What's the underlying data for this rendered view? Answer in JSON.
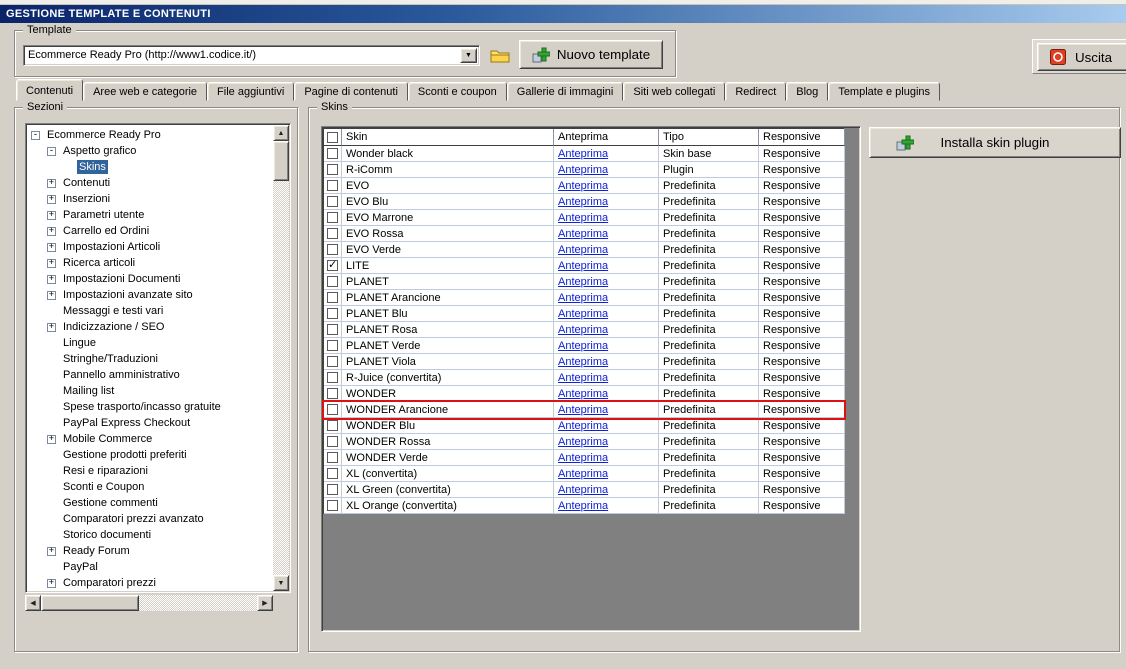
{
  "window": {
    "title": "GESTIONE TEMPLATE E CONTENUTI"
  },
  "colors": {
    "titlebar_start": "#0a246a",
    "titlebar_mid": "#2a5a9c",
    "titlebar_end": "#a8cbee",
    "selection": "#31639c",
    "link": "#0b20d8",
    "highlight": "#dd1111"
  },
  "template": {
    "group_label": "Template",
    "combo_value": "Ecommerce Ready Pro (http://www1.codice.it/)",
    "new_template_button": "Nuovo template",
    "exit_button": "Uscita"
  },
  "tabs": [
    "Contenuti",
    "Aree web e categorie",
    "File aggiuntivi",
    "Pagine di contenuti",
    "Sconti e coupon",
    "Gallerie di immagini",
    "Siti web collegati",
    "Redirect",
    "Blog",
    "Template e plugins"
  ],
  "active_tab": "Contenuti",
  "sections": {
    "group_label": "Sezioni",
    "tree": [
      {
        "label": "Ecommerce Ready Pro",
        "level": 0,
        "glyph": "-"
      },
      {
        "label": "Aspetto grafico",
        "level": 1,
        "glyph": "-"
      },
      {
        "label": "Skins",
        "level": 2,
        "glyph": "",
        "selected": true
      },
      {
        "label": "Contenuti",
        "level": 1,
        "glyph": "+"
      },
      {
        "label": "Inserzioni",
        "level": 1,
        "glyph": "+"
      },
      {
        "label": "Parametri utente",
        "level": 1,
        "glyph": "+"
      },
      {
        "label": "Carrello ed Ordini",
        "level": 1,
        "glyph": "+"
      },
      {
        "label": "Impostazioni Articoli",
        "level": 1,
        "glyph": "+"
      },
      {
        "label": "Ricerca articoli",
        "level": 1,
        "glyph": "+"
      },
      {
        "label": "Impostazioni Documenti",
        "level": 1,
        "glyph": "+"
      },
      {
        "label": "Impostazioni avanzate sito",
        "level": 1,
        "glyph": "+"
      },
      {
        "label": "Messaggi e testi vari",
        "level": 1,
        "glyph": ""
      },
      {
        "label": "Indicizzazione / SEO",
        "level": 1,
        "glyph": "+"
      },
      {
        "label": "Lingue",
        "level": 1,
        "glyph": ""
      },
      {
        "label": "Stringhe/Traduzioni",
        "level": 1,
        "glyph": ""
      },
      {
        "label": "Pannello amministrativo",
        "level": 1,
        "glyph": ""
      },
      {
        "label": "Mailing list",
        "level": 1,
        "glyph": ""
      },
      {
        "label": "Spese trasporto/incasso gratuite",
        "level": 1,
        "glyph": ""
      },
      {
        "label": "PayPal Express Checkout",
        "level": 1,
        "glyph": ""
      },
      {
        "label": "Mobile Commerce",
        "level": 1,
        "glyph": "+"
      },
      {
        "label": "Gestione prodotti preferiti",
        "level": 1,
        "glyph": ""
      },
      {
        "label": "Resi e riparazioni",
        "level": 1,
        "glyph": ""
      },
      {
        "label": "Sconti e Coupon",
        "level": 1,
        "glyph": ""
      },
      {
        "label": "Gestione commenti",
        "level": 1,
        "glyph": ""
      },
      {
        "label": "Comparatori prezzi avanzato",
        "level": 1,
        "glyph": ""
      },
      {
        "label": "Storico documenti",
        "level": 1,
        "glyph": ""
      },
      {
        "label": "Ready Forum",
        "level": 1,
        "glyph": "+"
      },
      {
        "label": "PayPal",
        "level": 1,
        "glyph": ""
      },
      {
        "label": "Comparatori prezzi",
        "level": 1,
        "glyph": "+"
      }
    ]
  },
  "skins": {
    "group_label": "Skins",
    "install_button": "Installa skin plugin",
    "columns": [
      "Skin",
      "Anteprima",
      "Tipo",
      "Responsive"
    ],
    "rows": [
      {
        "checked": false,
        "skin": "Wonder black",
        "anteprima": "Anteprima",
        "tipo": "Skin base",
        "responsive": "Responsive"
      },
      {
        "checked": false,
        "skin": "R-iComm",
        "anteprima": "Anteprima",
        "tipo": "Plugin",
        "responsive": "Responsive"
      },
      {
        "checked": false,
        "skin": "EVO",
        "anteprima": "Anteprima",
        "tipo": "Predefinita",
        "responsive": "Responsive"
      },
      {
        "checked": false,
        "skin": "EVO Blu",
        "anteprima": "Anteprima",
        "tipo": "Predefinita",
        "responsive": "Responsive"
      },
      {
        "checked": false,
        "skin": "EVO Marrone",
        "anteprima": "Anteprima",
        "tipo": "Predefinita",
        "responsive": "Responsive"
      },
      {
        "checked": false,
        "skin": "EVO Rossa",
        "anteprima": "Anteprima",
        "tipo": "Predefinita",
        "responsive": "Responsive"
      },
      {
        "checked": false,
        "skin": "EVO Verde",
        "anteprima": "Anteprima",
        "tipo": "Predefinita",
        "responsive": "Responsive"
      },
      {
        "checked": true,
        "skin": "LITE",
        "anteprima": "Anteprima",
        "tipo": "Predefinita",
        "responsive": "Responsive"
      },
      {
        "checked": false,
        "skin": "PLANET",
        "anteprima": "Anteprima",
        "tipo": "Predefinita",
        "responsive": "Responsive"
      },
      {
        "checked": false,
        "skin": "PLANET Arancione",
        "anteprima": "Anteprima",
        "tipo": "Predefinita",
        "responsive": "Responsive"
      },
      {
        "checked": false,
        "skin": "PLANET Blu",
        "anteprima": "Anteprima",
        "tipo": "Predefinita",
        "responsive": "Responsive"
      },
      {
        "checked": false,
        "skin": "PLANET Rosa",
        "anteprima": "Anteprima",
        "tipo": "Predefinita",
        "responsive": "Responsive"
      },
      {
        "checked": false,
        "skin": "PLANET Verde",
        "anteprima": "Anteprima",
        "tipo": "Predefinita",
        "responsive": "Responsive"
      },
      {
        "checked": false,
        "skin": "PLANET Viola",
        "anteprima": "Anteprima",
        "tipo": "Predefinita",
        "responsive": "Responsive"
      },
      {
        "checked": false,
        "skin": "R-Juice (convertita)",
        "anteprima": "Anteprima",
        "tipo": "Predefinita",
        "responsive": "Responsive"
      },
      {
        "checked": false,
        "skin": "WONDER",
        "anteprima": "Anteprima",
        "tipo": "Predefinita",
        "responsive": "Responsive"
      },
      {
        "checked": false,
        "skin": "WONDER Arancione",
        "anteprima": "Anteprima",
        "tipo": "Predefinita",
        "responsive": "Responsive",
        "highlighted": true
      },
      {
        "checked": false,
        "skin": "WONDER Blu",
        "anteprima": "Anteprima",
        "tipo": "Predefinita",
        "responsive": "Responsive"
      },
      {
        "checked": false,
        "skin": "WONDER Rossa",
        "anteprima": "Anteprima",
        "tipo": "Predefinita",
        "responsive": "Responsive"
      },
      {
        "checked": false,
        "skin": "WONDER Verde",
        "anteprima": "Anteprima",
        "tipo": "Predefinita",
        "responsive": "Responsive"
      },
      {
        "checked": false,
        "skin": "XL (convertita)",
        "anteprima": "Anteprima",
        "tipo": "Predefinita",
        "responsive": "Responsive"
      },
      {
        "checked": false,
        "skin": "XL Green (convertita)",
        "anteprima": "Anteprima",
        "tipo": "Predefinita",
        "responsive": "Responsive"
      },
      {
        "checked": false,
        "skin": "XL Orange (convertita)",
        "anteprima": "Anteprima",
        "tipo": "Predefinita",
        "responsive": "Responsive"
      }
    ]
  }
}
